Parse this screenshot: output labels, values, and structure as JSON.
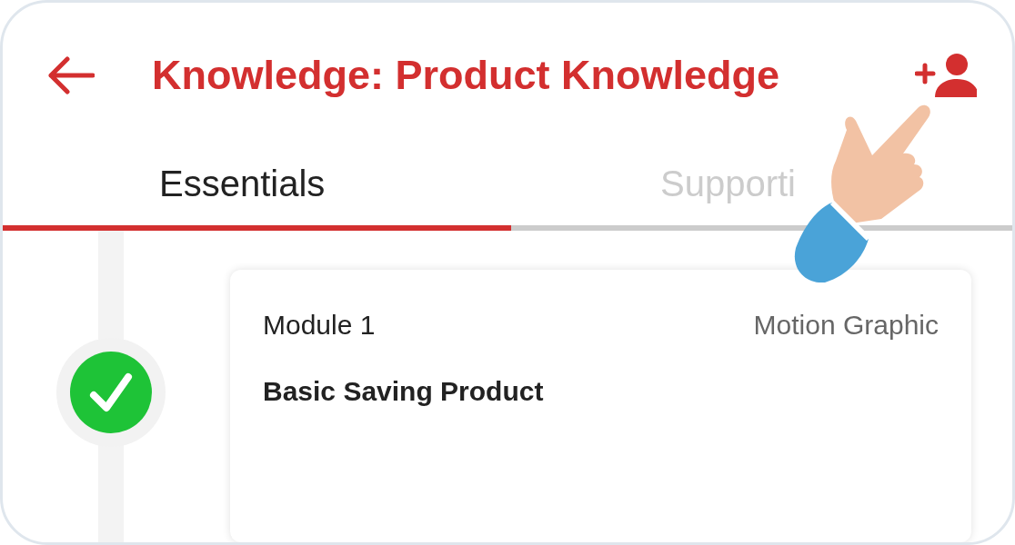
{
  "header": {
    "title": "Knowledge: Product Knowledge"
  },
  "tabs": [
    {
      "label": "Essentials",
      "selected": true
    },
    {
      "label": "Supporti",
      "selected": false
    }
  ],
  "modules": [
    {
      "label": "Module 1",
      "type": "Motion Graphic",
      "title": "Basic Saving Product",
      "completed": true
    }
  ]
}
